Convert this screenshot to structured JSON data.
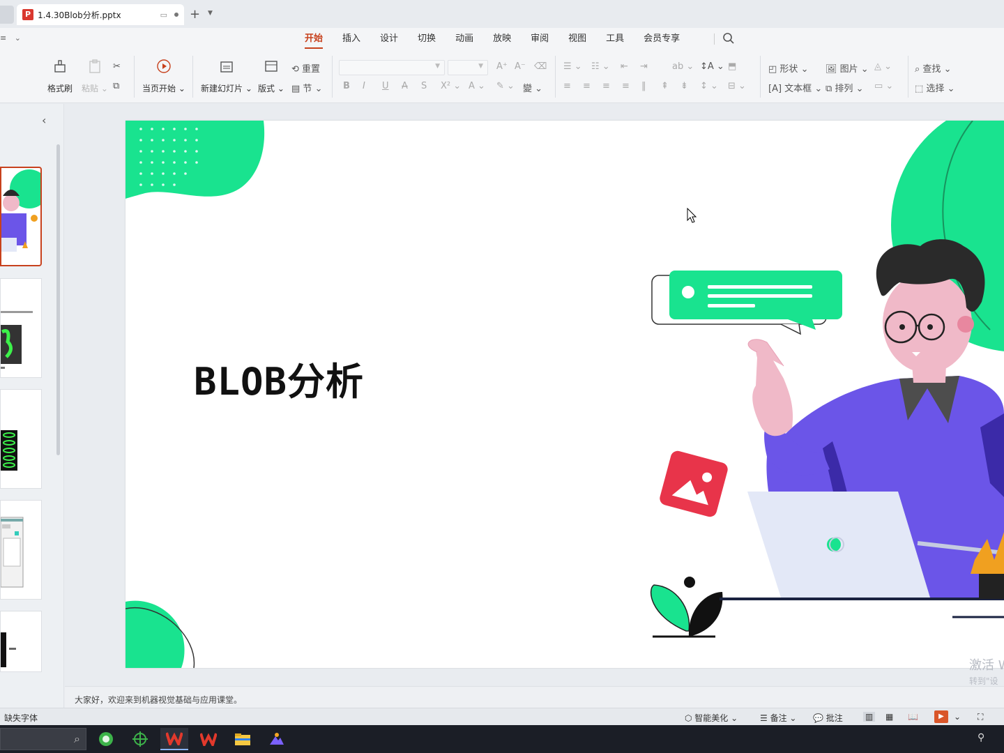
{
  "app": {
    "document_tab": {
      "title": "1.4.30Blob分析.pptx",
      "icon_letter": "P"
    },
    "new_tab_label": "+"
  },
  "menu": {
    "items": [
      "开始",
      "插入",
      "设计",
      "切换",
      "动画",
      "放映",
      "审阅",
      "视图",
      "工具",
      "会员专享"
    ],
    "active": "开始"
  },
  "ribbon": {
    "format_painter": "格式刷",
    "paste": "粘贴",
    "play_from_current": "当页开始",
    "new_slide": "新建幻灯片",
    "layout": "版式",
    "reset": "重置",
    "section": "节",
    "shape": "形状",
    "picture": "图片",
    "textbox": "文本框",
    "arrange": "排列",
    "find": "查找",
    "select": "选择"
  },
  "slide": {
    "title": "BLOB分析"
  },
  "notes": {
    "text": "大家好，欢迎来到机器视觉基础与应用课堂。"
  },
  "statusbar": {
    "missing_font": "缺失字体",
    "smart_beautify": "智能美化",
    "notes": "备注",
    "comments": "批注"
  },
  "watermark": {
    "line1": "激活 W",
    "line2": "转到\"设"
  },
  "colors": {
    "accent": "#c7411d",
    "slide_green": "#19e38f",
    "person_purple": "#6b55e8"
  }
}
